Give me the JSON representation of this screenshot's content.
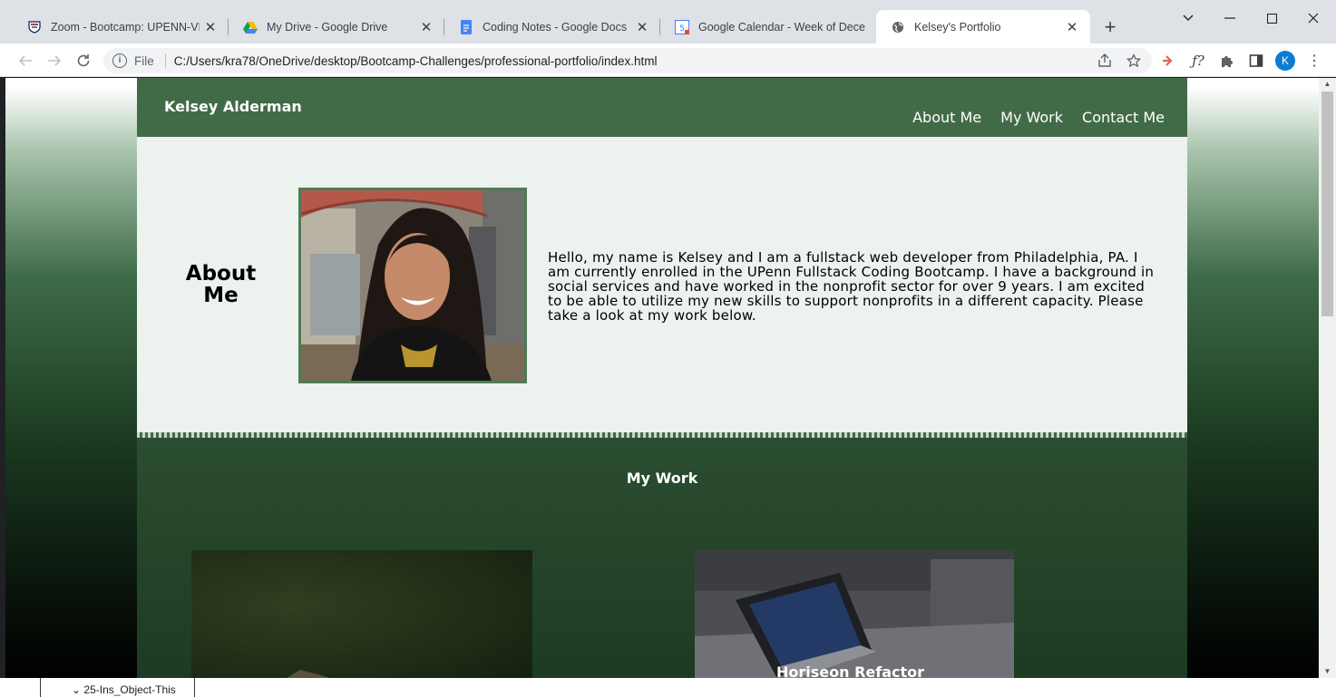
{
  "browser": {
    "tabs": [
      {
        "title": "Zoom - Bootcamp: UPENN-VIRT-",
        "icon": "upenn-shield-icon",
        "active": false
      },
      {
        "title": "My Drive - Google Drive",
        "icon": "google-drive-icon",
        "active": false
      },
      {
        "title": "Coding Notes - Google Docs",
        "icon": "google-docs-icon",
        "active": false
      },
      {
        "title": "Google Calendar - Week of Dece",
        "icon": "google-calendar-icon",
        "active": false
      },
      {
        "title": "Kelsey's Portfolio",
        "icon": "globe-icon",
        "active": true
      }
    ],
    "address": {
      "scheme_label": "File",
      "url": "C:/Users/kra78/OneDrive/desktop/Bootcamp-Challenges/professional-portfolio/index.html"
    },
    "profile_initial": "K"
  },
  "page": {
    "brand": "Kelsey Alderman",
    "nav": [
      "About Me",
      "My Work",
      "Contact Me"
    ],
    "about": {
      "heading": "About Me",
      "text": "Hello, my name is Kelsey and I am a fullstack web developer from Philadelphia, PA. I am currently enrolled in the UPenn Fullstack Coding Bootcamp. I have a background in social services and have worked in the nonprofit sector for over 9 years. I am excited to be able to utilize my new skills to support nonprofits in a different capacity. Please take a look at my work below."
    },
    "work": {
      "heading": "My Work",
      "projects": [
        "Horiseon Refactor"
      ]
    }
  },
  "taskbar": {
    "item": "25-Ins_Object-This"
  },
  "colors": {
    "header_green": "#416b47",
    "about_bg": "#ecf2ed",
    "work_bg": "#2b4d31"
  }
}
